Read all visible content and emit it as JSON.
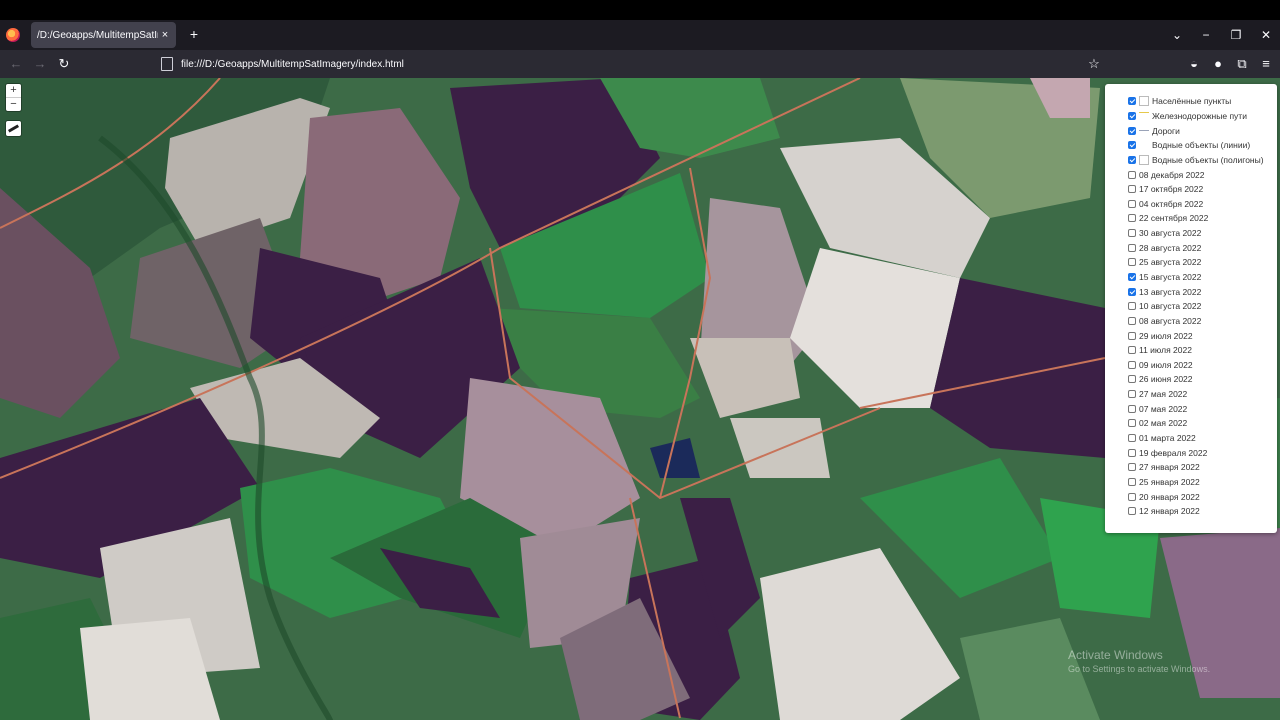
{
  "tab": {
    "title": "/D:/Geoapps/MultitempSatImagery/",
    "close": "×",
    "new_tab": "+"
  },
  "window_controls": {
    "list": "⌄",
    "minimize": "−",
    "restore": "❐",
    "close": "✕"
  },
  "nav": {
    "back": "←",
    "forward": "→",
    "reload": "↻",
    "url": "file:///D:/Geoapps/MultitempSatImagery/index.html",
    "bookmark": "☆",
    "pocket": "◒",
    "account": "●",
    "extensions": "⧉",
    "menu": "≡"
  },
  "map_controls": {
    "zoom_in": "+",
    "zoom_out": "−",
    "measure_icon": "ruler-icon"
  },
  "layers": [
    {
      "label": "Населённые пункты",
      "checked": true,
      "swatch": "box"
    },
    {
      "label": "Железнодорожные пути",
      "checked": true,
      "swatch": "line"
    },
    {
      "label": "Дороги",
      "checked": true,
      "swatch": "road"
    },
    {
      "label": "Водные объекты (линии)",
      "checked": true,
      "swatch": "none"
    },
    {
      "label": "Водные объекты (полигоны)",
      "checked": true,
      "swatch": "box"
    },
    {
      "label": "08 декабря 2022",
      "checked": false
    },
    {
      "label": "17 октября 2022",
      "checked": false
    },
    {
      "label": "04 октября 2022",
      "checked": false
    },
    {
      "label": "22 сентября 2022",
      "checked": false
    },
    {
      "label": "30 августа 2022",
      "checked": false
    },
    {
      "label": "28 августа 2022",
      "checked": false
    },
    {
      "label": "25 августа 2022",
      "checked": false
    },
    {
      "label": "15 августа 2022",
      "checked": true
    },
    {
      "label": "13 августа 2022",
      "checked": true
    },
    {
      "label": "10 августа 2022",
      "checked": false
    },
    {
      "label": "08 августа 2022",
      "checked": false
    },
    {
      "label": "29 июля 2022",
      "checked": false
    },
    {
      "label": "11 июля 2022",
      "checked": false
    },
    {
      "label": "09 июля 2022",
      "checked": false
    },
    {
      "label": "26 июня 2022",
      "checked": false
    },
    {
      "label": "27 мая 2022",
      "checked": false
    },
    {
      "label": "07 мая 2022",
      "checked": false
    },
    {
      "label": "02 мая 2022",
      "checked": false
    },
    {
      "label": "01 марта 2022",
      "checked": false
    },
    {
      "label": "19 февраля 2022",
      "checked": false
    },
    {
      "label": "27 января 2022",
      "checked": false
    },
    {
      "label": "25 января 2022",
      "checked": false
    },
    {
      "label": "20 января 2022",
      "checked": false
    },
    {
      "label": "12 января 2022",
      "checked": false
    }
  ],
  "watermark": {
    "line1": "Activate Windows",
    "line2": "Go to Settings to activate Windows."
  }
}
